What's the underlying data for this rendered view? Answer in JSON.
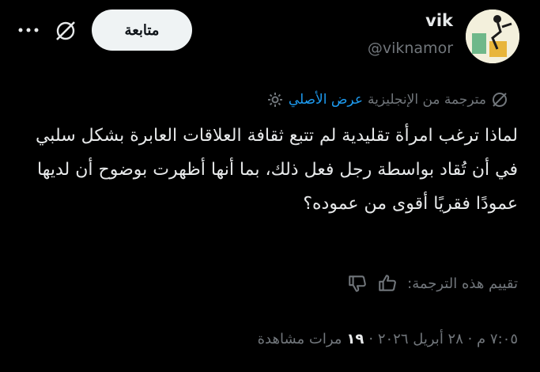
{
  "user": {
    "name": "vik",
    "handle": "@viknamor"
  },
  "header": {
    "follow_label": "متابعة",
    "more_icon": "more-icon",
    "grok_icon": "grok-icon"
  },
  "translation": {
    "label": "مترجمة من الإنجليزية",
    "show_original": "عرض الأصلي",
    "icons": [
      "translate-icon",
      "gear-icon"
    ]
  },
  "tweet": {
    "text": "لماذا ترغب امرأة تقليدية لم تتبع ثقافة العلاقات العابرة بشكل سلبي في أن تُقاد بواسطة رجل فعل ذلك، بما أنها أظهرت بوضوح أن لديها عمودًا فقريًا أقوى من عموده؟"
  },
  "rating": {
    "label": "تقييم هذه الترجمة:",
    "icons": [
      "thumbs-up-icon",
      "thumbs-down-icon"
    ]
  },
  "meta": {
    "timestamp": "٧:٠٥ م · ٢٨ أبريل ٢٠٢٦ ·",
    "views_count": "١٩",
    "views_label": "مرات مشاهدة"
  },
  "colors": {
    "background": "#000000",
    "text": "#e7e9ea",
    "secondary": "#71767b",
    "link": "#1d9bf0",
    "button_bg": "#eff3f4"
  }
}
